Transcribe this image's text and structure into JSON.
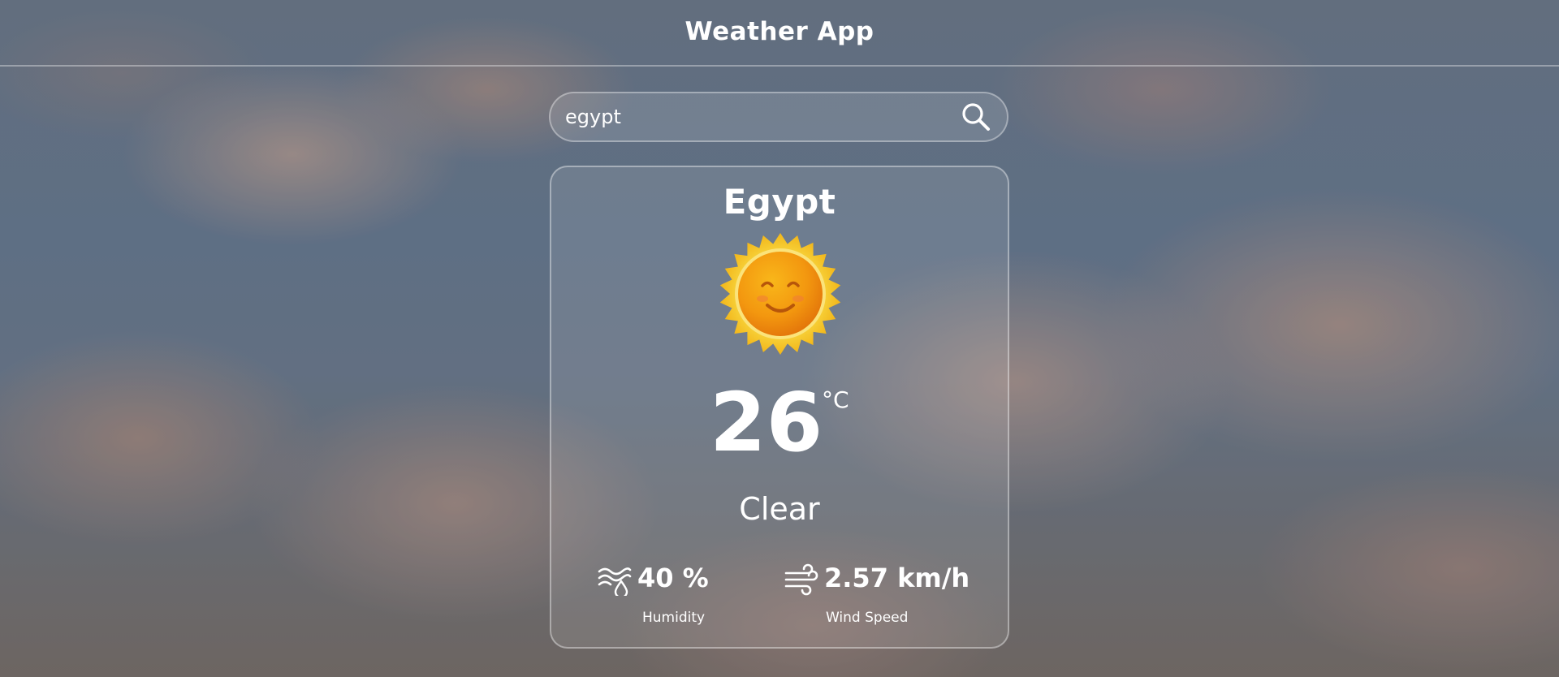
{
  "header": {
    "title": "Weather App"
  },
  "search": {
    "value": "egypt",
    "icon": "search-icon"
  },
  "weather": {
    "city": "Egypt",
    "icon": "smiling-sun-icon",
    "temperature": "26",
    "unit": "°C",
    "condition": "Clear",
    "humidity": {
      "value": "40 %",
      "label": "Humidity",
      "icon": "humidity-icon"
    },
    "wind": {
      "value": "2.57 km/h",
      "label": "Wind Speed",
      "icon": "wind-icon"
    }
  },
  "colors": {
    "text": "#ffffff",
    "sun_outer": "#f5c518",
    "sun_inner": "#f08a0c"
  }
}
